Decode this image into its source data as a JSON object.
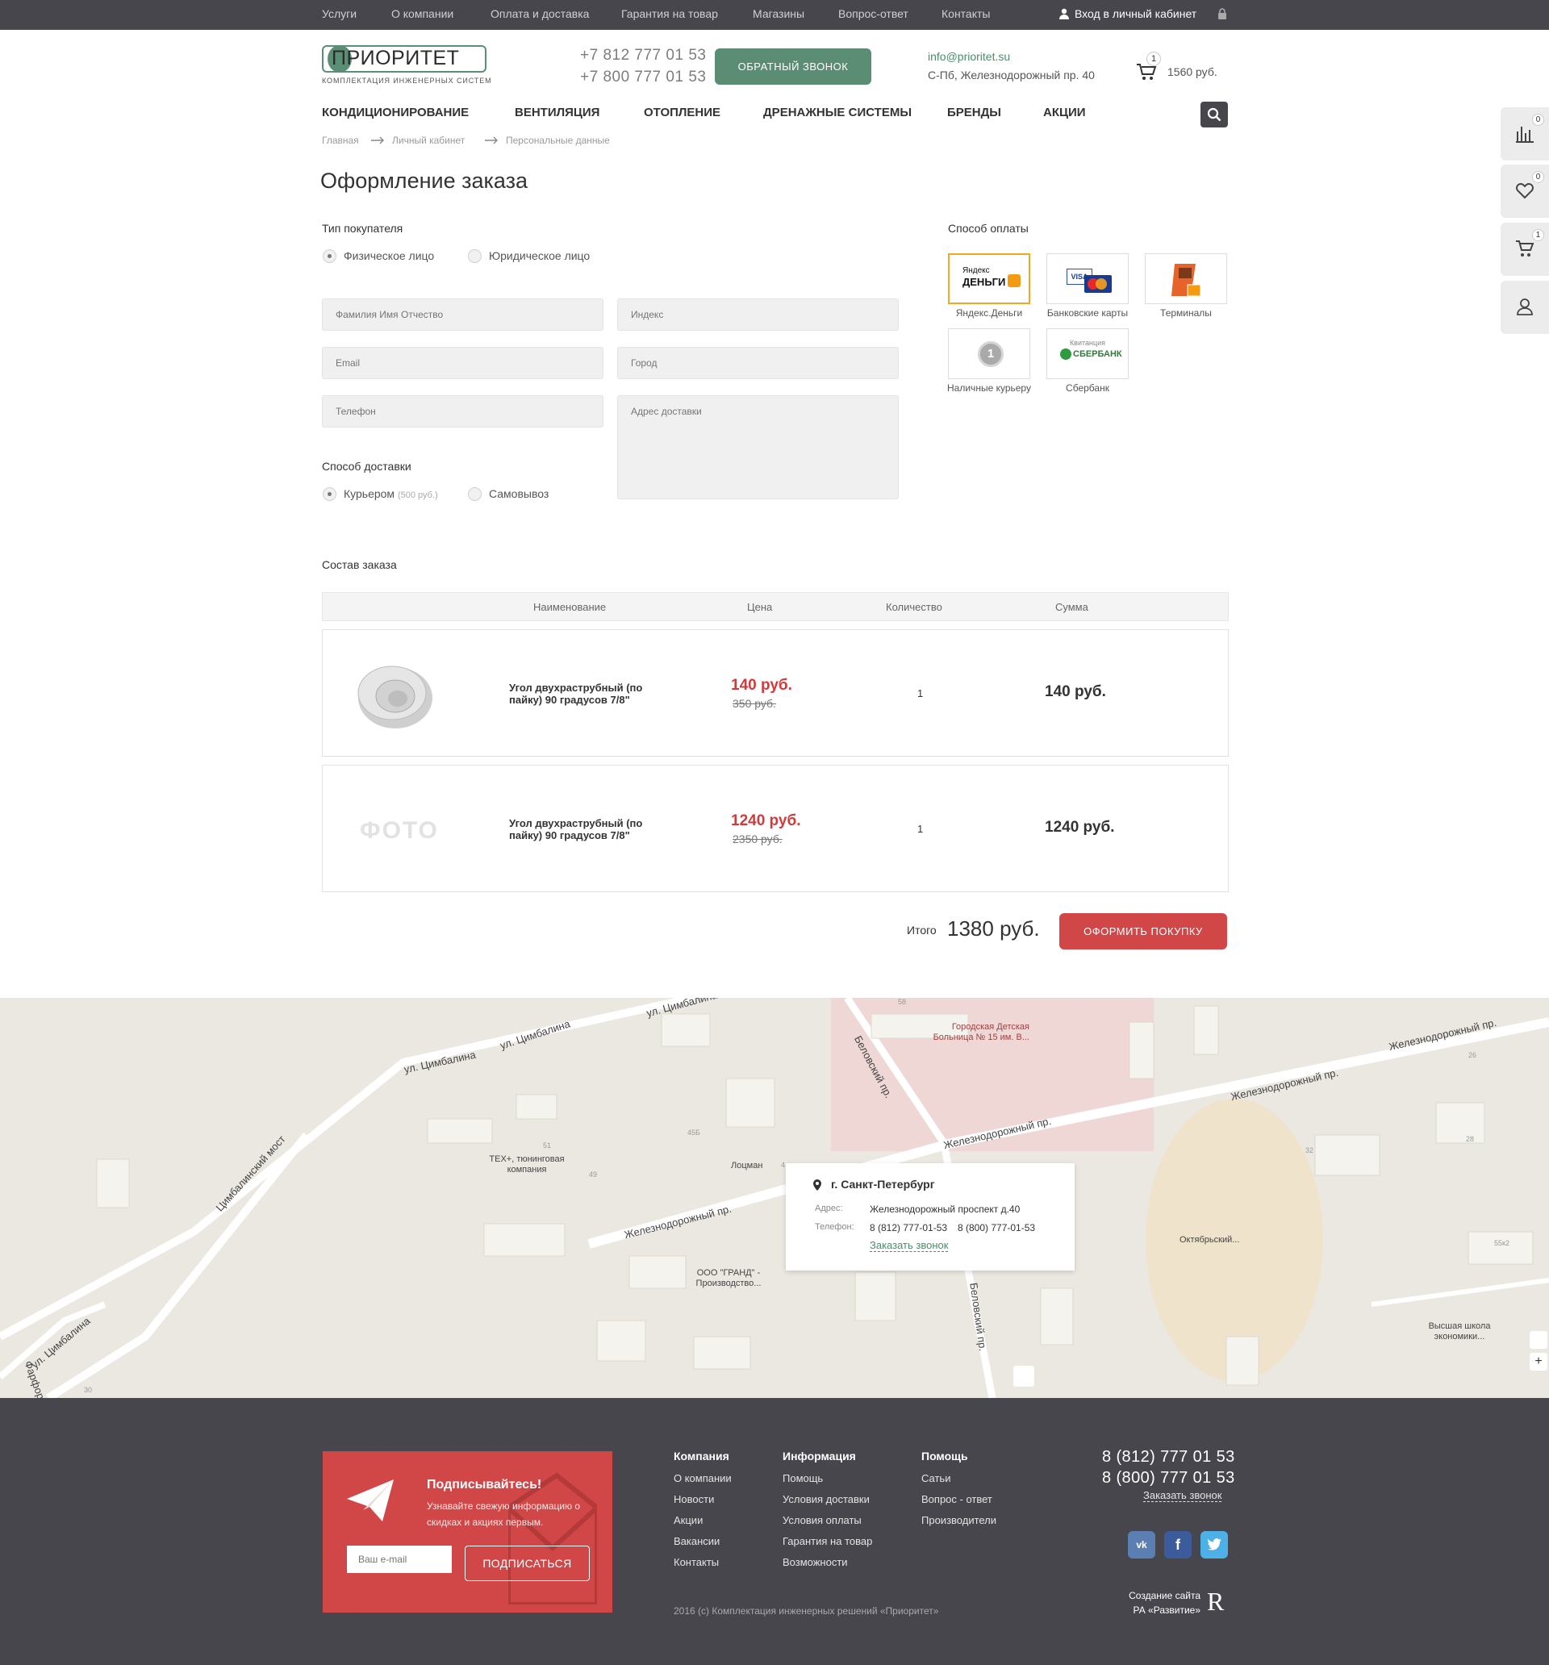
{
  "topnav": {
    "links": [
      "Услуги",
      "О компании",
      "Оплата и доставка",
      "Гарантия на товар",
      "Магазины",
      "Вопрос-ответ",
      "Контакты"
    ],
    "login": "Вход в личный кабинет"
  },
  "header": {
    "logo_title": "ПРИОРИТЕТ",
    "logo_sub": "КОМПЛЕКТАЦИЯ ИНЖЕНЕРНЫХ СИСТЕМ",
    "phone1": "+7 812 777 01 53",
    "phone2": "+7 800 777 01 53",
    "callback_button": "ОБРАТНЫЙ ЗВОНОК",
    "email": "info@prioritet.su",
    "address": "С-Пб, Железнодорожный пр. 40",
    "cart_count": "1",
    "cart_sum": "1560 руб."
  },
  "mainnav": [
    "КОНДИЦИОНИРОВАНИЕ",
    "ВЕНТИЛЯЦИЯ",
    "ОТОПЛЕНИЕ",
    "ДРЕНАЖНЫЕ СИСТЕМЫ",
    "БРЕНДЫ",
    "АКЦИИ"
  ],
  "breadcrumb": [
    "Главная",
    "Личный кабинет",
    "Персональные данные"
  ],
  "sidebar": {
    "compare_count": "0",
    "favorites_count": "0",
    "cart_count": "1"
  },
  "page_title": "Оформление заказа",
  "form": {
    "buyer_type_label": "Тип покупателя",
    "buyer_types": [
      "Физическое лицо",
      "Юридическое лицо"
    ],
    "fields": {
      "fio": "Фамилия Имя Отчество",
      "email": "Email",
      "phone": "Телефон",
      "index": "Индекс",
      "city": "Город",
      "address": "Адрес доставки"
    },
    "delivery_label": "Способ доставки",
    "delivery_courier": "Курьером",
    "delivery_courier_price": "(500 руб.)",
    "delivery_pickup": "Самовывоз"
  },
  "payment": {
    "label": "Способ оплаты",
    "methods": [
      "Яндекс.Деньги",
      "Банковские карты",
      "Терминалы",
      "Наличные курьеру",
      "Сбербанк"
    ],
    "yandex_logo_top": "Яндекс",
    "yandex_logo_bottom": "ДЕНЬГИ",
    "visa": "VISA",
    "mastercard": "MasterCard",
    "coin": "1",
    "sber_top": "Квитанция",
    "sber_name": "СБЕРБАНК"
  },
  "order": {
    "label": "Состав заказа",
    "columns": [
      "Наименование",
      "Цена",
      "Количество",
      "Сумма"
    ],
    "items": [
      {
        "name": "Угол двухраструбный (по пайку) 90 градусов 7/8\"",
        "price": "140 руб.",
        "old_price": "350 руб.",
        "qty": "1",
        "sum": "140 руб.",
        "image": "product-photo"
      },
      {
        "name": "Угол двухраструбный (по пайку) 90 градусов 7/8\"",
        "price": "1240 руб.",
        "old_price": "2350 руб.",
        "qty": "1",
        "sum": "1240 руб.",
        "image": "ФОТО"
      }
    ],
    "total_label": "Итого",
    "total": "1380 руб.",
    "submit": "ОФОРМИТЬ ПОКУПКУ"
  },
  "map": {
    "streets": [
      "ул. Цимбалина",
      "ул. Цимбалина",
      "ул. Цимбалина",
      "ул. Цимбалина",
      "Цимбалинский мост",
      "Беловский пр.",
      "Железнодорожный пр.",
      "Железнодорожный пр.",
      "Железнодорожный пр.",
      "Железнодорожный пр.",
      "Беловский пр.",
      "Фарфоров..."
    ],
    "places": [
      "Городская Детская Больница № 15 им. В...",
      "ТЕХ+, тюнинговая компания",
      "Лоцман",
      "ООО \"ГРАНД\" - Производство...",
      "Октябрьский...",
      "Высшая школа экономики..."
    ],
    "house_numbers": [
      "58",
      "26",
      "45Б",
      "51",
      "49",
      "4",
      "32",
      "28",
      "55к2",
      "30"
    ],
    "card": {
      "city": "г. Санкт-Петербург",
      "address_label": "Адрес:",
      "address": "Железнодорожный проспект д.40",
      "phone_label": "Телефон:",
      "phone1": "8 (812) 777-01-53",
      "phone2": "8 (800) 777-01-53",
      "callback": "Заказать звонок"
    },
    "zoom_in": "+"
  },
  "footer": {
    "subscribe_title": "Подписывайтесь!",
    "subscribe_text": "Узнавайте свежую информацию о скидках и акциях первым.",
    "email_placeholder": "Ваш e-mail",
    "subscribe_button": "ПОДПИСАТЬСЯ",
    "columns": [
      {
        "title": "Компания",
        "links": [
          "О компании",
          "Новости",
          "Акции",
          "Вакансии",
          "Контакты"
        ]
      },
      {
        "title": "Информация",
        "links": [
          "Помощь",
          "Условия доставки",
          "Условия оплаты",
          "Гарантия на товар",
          "Возможности"
        ]
      },
      {
        "title": "Помощь",
        "links": [
          "Сатьи",
          "Вопрос - ответ",
          "Производители"
        ]
      }
    ],
    "phone1": "8 (812) 777 01 53",
    "phone2": "8 (800) 777 01 53",
    "callback": "Заказать звонок",
    "copyright": "2016 (с) Комплектация инженерных решений «Приоритет»",
    "credit_line1": "Создание сайта",
    "credit_line2": "РА «Развитие»",
    "credit_logo": "R",
    "social": [
      "vk",
      "facebook",
      "twitter"
    ],
    "social_labels": [
      "vk",
      "f",
      ""
    ],
    "colors": {
      "vk": "#5b7fb3",
      "facebook": "#3b5b9a",
      "twitter": "#4db1e8"
    }
  },
  "colors": {
    "accent_green": "#5b8d74",
    "accent_red": "#d14747",
    "dark": "#47464d",
    "price_red": "#d43a3a"
  }
}
